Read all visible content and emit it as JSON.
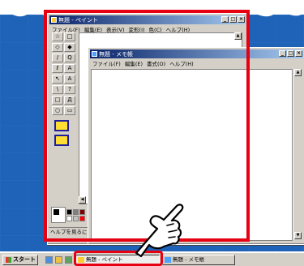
{
  "paint": {
    "title": "無題 - ペイント",
    "menu": [
      "ファイル(F)",
      "編集(E)",
      "表示(V)",
      "変形(I)",
      "色(C)",
      "ヘルプ(H)"
    ],
    "status": "ヘルプを見るには,",
    "window_buttons": [
      "_",
      "□",
      "×"
    ]
  },
  "notepad": {
    "title": "無題 - メモ帳",
    "menu": [
      "ファイル(F)",
      "編集(E)",
      "書式(O)",
      "ヘルプ(H)"
    ],
    "window_buttons": [
      "_",
      "□",
      "×"
    ]
  },
  "tools": [
    "☆",
    "□",
    "◇",
    "◆",
    "/",
    "Q",
    "ℓ",
    "A",
    "↖",
    "A",
    "\\",
    "?",
    "□",
    "Д",
    "○",
    "▭"
  ],
  "palette": [
    "#000000",
    "#808080",
    "#800000",
    "#ffffff",
    "#c0c0c0",
    "#ff0000"
  ],
  "taskbar": {
    "start_label": "スタート",
    "tasks": [
      "無題 - ペイント",
      "無題 - メモ帳"
    ]
  },
  "colors": {
    "highlight": "#e60012",
    "desktop": "#1f63b8",
    "titlebar": "#0a246a"
  }
}
